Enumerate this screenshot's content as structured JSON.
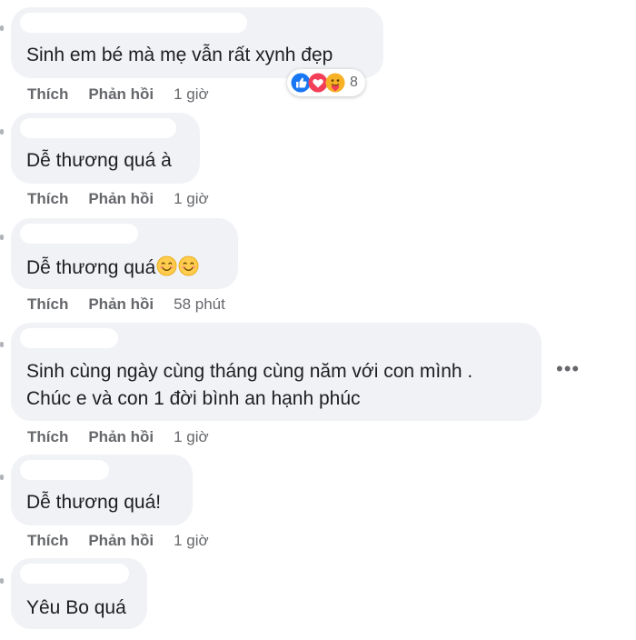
{
  "action_labels": {
    "like": "Thích",
    "reply": "Phản hồi"
  },
  "comments": [
    {
      "text": "Sinh em bé mà mẹ vẫn rất xynh đẹp",
      "time": "1 giờ",
      "reaction_count": "8"
    },
    {
      "text": "Dễ thương quá à",
      "time": "1 giờ"
    },
    {
      "text": "Dễ thương quá",
      "emoji": "smiling-face-icon",
      "time": "58 phút"
    },
    {
      "lines": [
        "Sinh cùng ngày cùng tháng cùng năm với con mình .",
        "Chúc e và con 1 đời bình an hạnh phúc"
      ],
      "time": "1 giờ"
    },
    {
      "text": "Dễ thương quá!",
      "time": "1 giờ"
    },
    {
      "text": "Yêu Bo quá"
    }
  ],
  "icons": {
    "like": "like-reaction-icon",
    "love": "love-reaction-icon",
    "care": "care-reaction-icon",
    "more": "more-options-icon"
  },
  "colors": {
    "bubble": "#f0f2f5",
    "like_blue": "#1877f2",
    "love_red": "#f33e58",
    "care_yellow": "#f7b125"
  }
}
